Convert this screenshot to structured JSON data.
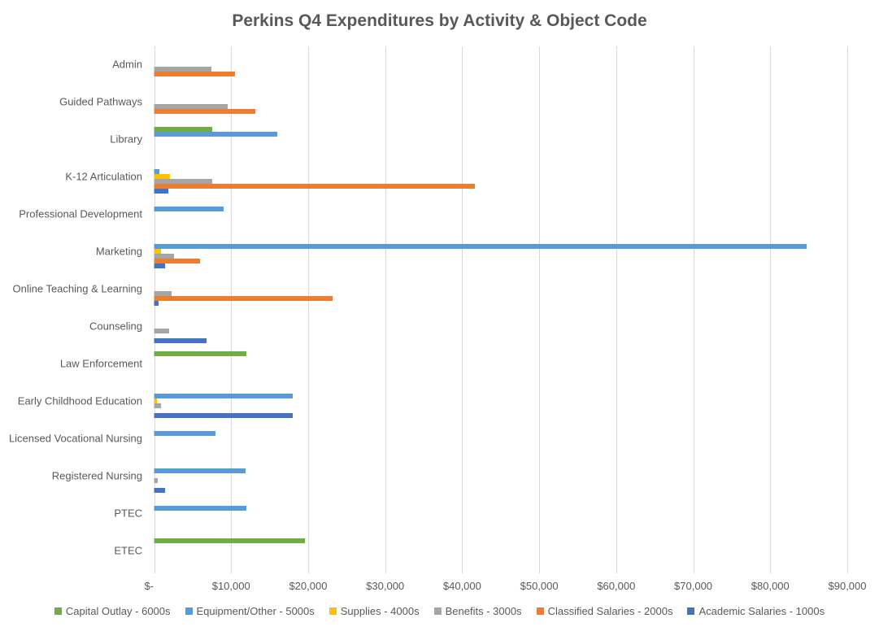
{
  "chart_data": {
    "type": "bar",
    "orientation": "horizontal",
    "title": "Perkins Q4 Expenditures by Activity & Object Code",
    "xlabel": "",
    "ylabel": "",
    "xlim": [
      0,
      90000
    ],
    "x_ticks": [
      0,
      10000,
      20000,
      30000,
      40000,
      50000,
      60000,
      70000,
      80000,
      90000
    ],
    "x_tick_labels": [
      "$-",
      "$10,000",
      "$20,000",
      "$30,000",
      "$40,000",
      "$50,000",
      "$60,000",
      "$70,000",
      "$80,000",
      "$90,000"
    ],
    "grid": "vertical",
    "legend_position": "bottom",
    "categories": [
      "Admin",
      "Guided Pathways",
      "Library",
      "K-12 Articulation",
      "Professional Development",
      "Marketing",
      "Online Teaching & Learning",
      "Counseling",
      "Law Enforcement",
      "Early Childhood Education",
      "Licensed Vocational Nursing",
      "Registered Nursing",
      "PTEC",
      "ETEC"
    ],
    "series": [
      {
        "name": "Capital Outlay - 6000s",
        "color": "#70AD47",
        "values": [
          0,
          0,
          7550,
          0,
          0,
          0,
          0,
          0,
          11980,
          0,
          0,
          0,
          0,
          19590
        ]
      },
      {
        "name": "Equipment/Other - 5000s",
        "color": "#5B9BD5",
        "values": [
          0,
          0,
          16000,
          690,
          9030,
          84740,
          0,
          0,
          0,
          18000,
          7970,
          11880,
          11980,
          0
        ]
      },
      {
        "name": "Supplies - 4000s",
        "color": "#FFC000",
        "values": [
          0,
          0,
          0,
          2050,
          0,
          900,
          0,
          0,
          0,
          370,
          0,
          0,
          0,
          0
        ]
      },
      {
        "name": "Benefits - 3000s",
        "color": "#A5A5A5",
        "values": [
          7450,
          9550,
          0,
          7550,
          0,
          2590,
          2270,
          1950,
          0,
          900,
          0,
          480,
          0,
          0
        ]
      },
      {
        "name": "Classified Salaries - 2000s",
        "color": "#ED7D31",
        "values": [
          10500,
          13150,
          0,
          41650,
          0,
          5970,
          23180,
          0,
          0,
          0,
          0,
          0,
          0,
          0
        ]
      },
      {
        "name": "Academic Salaries - 1000s",
        "color": "#4472C4",
        "values": [
          0,
          0,
          0,
          1850,
          0,
          1430,
          580,
          6810,
          0,
          18000,
          0,
          1430,
          0,
          0
        ]
      }
    ]
  }
}
